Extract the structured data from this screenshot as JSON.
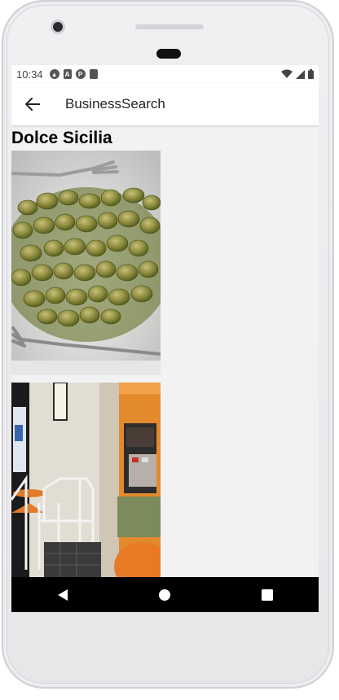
{
  "status_bar": {
    "time": "10:34",
    "left_icons": [
      "assistant-icon",
      "a-icon",
      "p-icon",
      "sd-card-icon"
    ],
    "right_icons": [
      "wifi-icon",
      "signal-icon",
      "battery-icon"
    ]
  },
  "app_bar": {
    "back_icon": "arrow-left-icon",
    "title": "BusinessSearch"
  },
  "business": {
    "name": "Dolce Sicilia",
    "photos": [
      {
        "subject": "gnocchi-pesto-photo"
      },
      {
        "subject": "restaurant-interior-photo"
      }
    ]
  },
  "nav_bar": {
    "buttons": [
      "back-triangle-icon",
      "home-circle-icon",
      "recents-square-icon"
    ]
  },
  "colors": {
    "screen_bg": "#f2f2f3",
    "app_bar_bg": "#ffffff",
    "nav_bar_bg": "#000000",
    "text_primary": "#000000"
  }
}
